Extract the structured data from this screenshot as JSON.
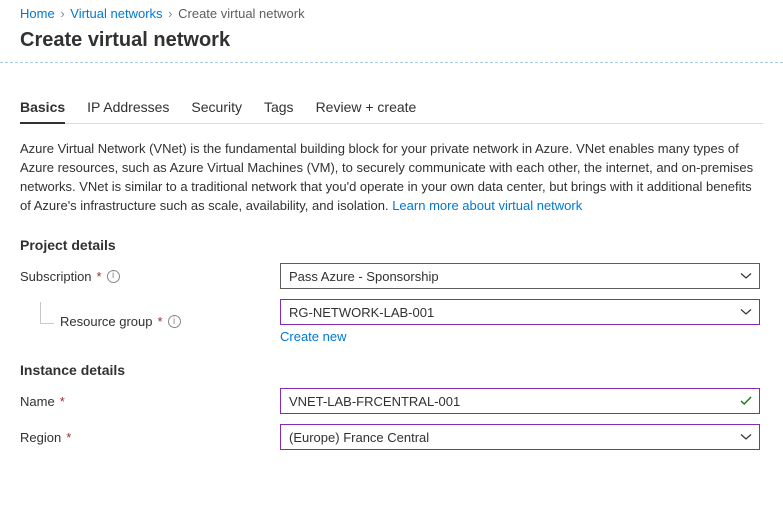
{
  "breadcrumbs": {
    "home": "Home",
    "vnets": "Virtual networks",
    "current": "Create virtual network"
  },
  "title": "Create virtual network",
  "tabs": {
    "basics": "Basics",
    "ip": "IP Addresses",
    "security": "Security",
    "tags": "Tags",
    "review": "Review + create"
  },
  "intro": {
    "text": "Azure Virtual Network (VNet) is the fundamental building block for your private network in Azure. VNet enables many types of Azure resources, such as Azure Virtual Machines (VM), to securely communicate with each other, the internet, and on-premises networks. VNet is similar to a traditional network that you'd operate in your own data center, but brings with it additional benefits of Azure's infrastructure such as scale, availability, and isolation.  ",
    "link": "Learn more about virtual network"
  },
  "sections": {
    "project": "Project details",
    "instance": "Instance details"
  },
  "fields": {
    "subscription": {
      "label": "Subscription",
      "value": "Pass Azure - Sponsorship"
    },
    "resourceGroup": {
      "label": "Resource group",
      "value": "RG-NETWORK-LAB-001",
      "createNew": "Create new"
    },
    "name": {
      "label": "Name",
      "value": "VNET-LAB-FRCENTRAL-001"
    },
    "region": {
      "label": "Region",
      "value": "(Europe) France Central"
    }
  }
}
